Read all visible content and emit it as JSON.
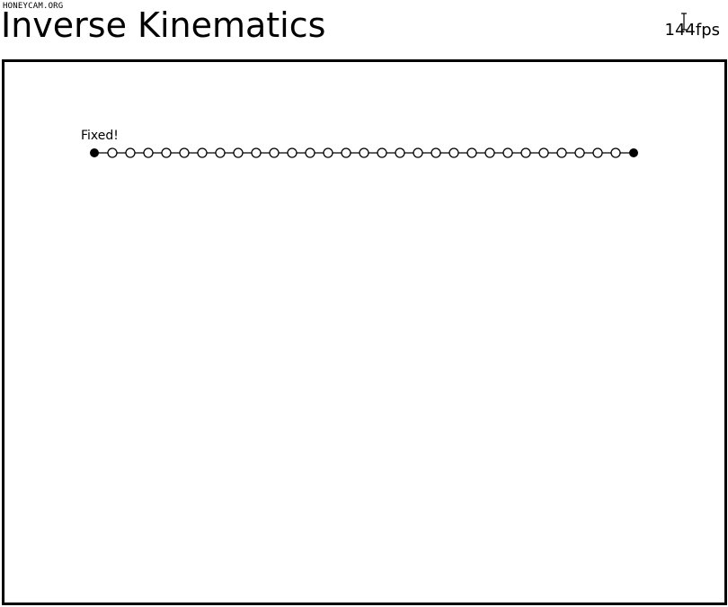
{
  "watermark": "HONEYCAM.ORG",
  "header": {
    "title": "Inverse Kinematics",
    "fps": "144fps"
  },
  "canvas": {
    "label": "Fixed!",
    "chain": {
      "joint_count": 31,
      "fixed_endpoints": [
        "start",
        "end"
      ]
    }
  },
  "colors": {
    "foreground": "#000000",
    "background": "#ffffff"
  }
}
